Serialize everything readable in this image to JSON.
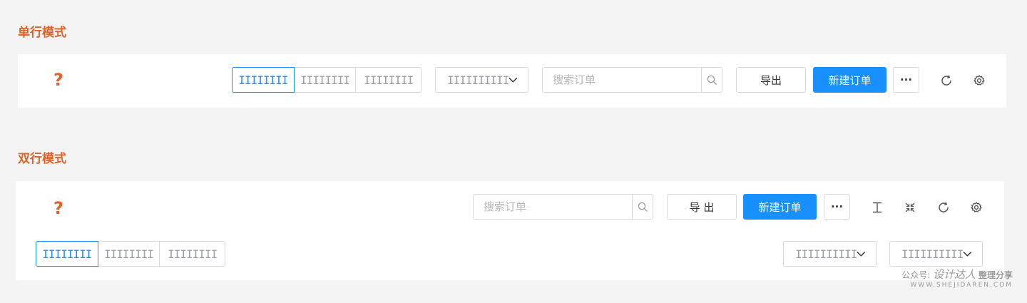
{
  "single": {
    "title": "单行模式",
    "help_glyph": "?",
    "tabs": [
      "IIIIIIII",
      "IIIIIIII",
      "IIIIIIII"
    ],
    "select": {
      "value": "IIIIIIIIII"
    },
    "search": {
      "placeholder": "搜索订单"
    },
    "export_label": "导出",
    "create_label": "新建订单",
    "more_label": "···"
  },
  "double": {
    "title": "双行模式",
    "help_glyph": "?",
    "tabs": [
      "IIIIIIII",
      "IIIIIIII",
      "IIIIIIII"
    ],
    "select1": {
      "value": "IIIIIIIIII"
    },
    "select2": {
      "value": "IIIIIIIIII"
    },
    "search": {
      "placeholder": "搜索订单"
    },
    "export_label": "导 出",
    "create_label": "新建订单",
    "more_label": "···"
  },
  "watermark": {
    "prefix": "公众号:",
    "name": "设计达人",
    "suffix": "整理分享",
    "url": "WWW.SHEJIDAREN.COM"
  },
  "colors": {
    "accent": "#1890ff",
    "title": "#e2622a",
    "border": "#d9d9d9",
    "background": "#f4f4f4"
  },
  "icons": [
    "search-icon",
    "chevron-down-icon",
    "refresh-icon",
    "settings-icon",
    "text-height-icon",
    "collapse-icon",
    "help-icon"
  ]
}
